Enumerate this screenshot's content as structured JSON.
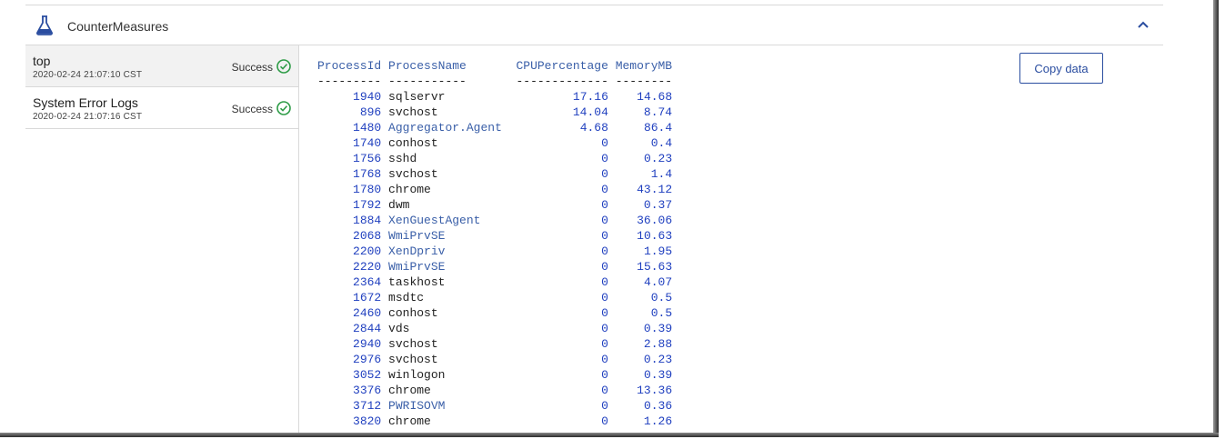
{
  "header": {
    "title": "CounterMeasures",
    "icon": "flask-icon",
    "collapse_icon": "chevron-up-icon"
  },
  "tasks": [
    {
      "name": "top",
      "time": "2020-02-24 21:07:10 CST",
      "status": "Success",
      "selected": true
    },
    {
      "name": "System Error Logs",
      "time": "2020-02-24 21:07:16 CST",
      "status": "Success",
      "selected": false
    }
  ],
  "output": {
    "copy_label": "Copy data",
    "headers": [
      "ProcessId",
      "ProcessName",
      "CPUPercentage",
      "MemoryMB"
    ],
    "separators": [
      "---------",
      "-----------",
      "-------------",
      "--------"
    ],
    "rows": [
      [
        "1940",
        "sqlservr",
        "17.16",
        "14.68"
      ],
      [
        "896",
        "svchost",
        "14.04",
        "8.74"
      ],
      [
        "1480",
        "Aggregator.Agent",
        "4.68",
        "86.4"
      ],
      [
        "1740",
        "conhost",
        "0",
        "0.4"
      ],
      [
        "1756",
        "sshd",
        "0",
        "0.23"
      ],
      [
        "1768",
        "svchost",
        "0",
        "1.4"
      ],
      [
        "1780",
        "chrome",
        "0",
        "43.12"
      ],
      [
        "1792",
        "dwm",
        "0",
        "0.37"
      ],
      [
        "1884",
        "XenGuestAgent",
        "0",
        "36.06"
      ],
      [
        "2068",
        "WmiPrvSE",
        "0",
        "10.63"
      ],
      [
        "2200",
        "XenDpriv",
        "0",
        "1.95"
      ],
      [
        "2220",
        "WmiPrvSE",
        "0",
        "15.63"
      ],
      [
        "2364",
        "taskhost",
        "0",
        "4.07"
      ],
      [
        "1672",
        "msdtc",
        "0",
        "0.5"
      ],
      [
        "2460",
        "conhost",
        "0",
        "0.5"
      ],
      [
        "2844",
        "vds",
        "0",
        "0.39"
      ],
      [
        "2940",
        "svchost",
        "0",
        "2.88"
      ],
      [
        "2976",
        "svchost",
        "0",
        "0.23"
      ],
      [
        "3052",
        "winlogon",
        "0",
        "0.39"
      ],
      [
        "3376",
        "chrome",
        "0",
        "13.36"
      ],
      [
        "3712",
        "PWRISOVM",
        "0",
        "0.36"
      ],
      [
        "3820",
        "chrome",
        "0",
        "1.26"
      ]
    ]
  },
  "colors": {
    "accent": "#2a4da0",
    "success": "#2e9c47",
    "header_text": "#3a5fa8",
    "value_text": "#1f3fbf"
  }
}
